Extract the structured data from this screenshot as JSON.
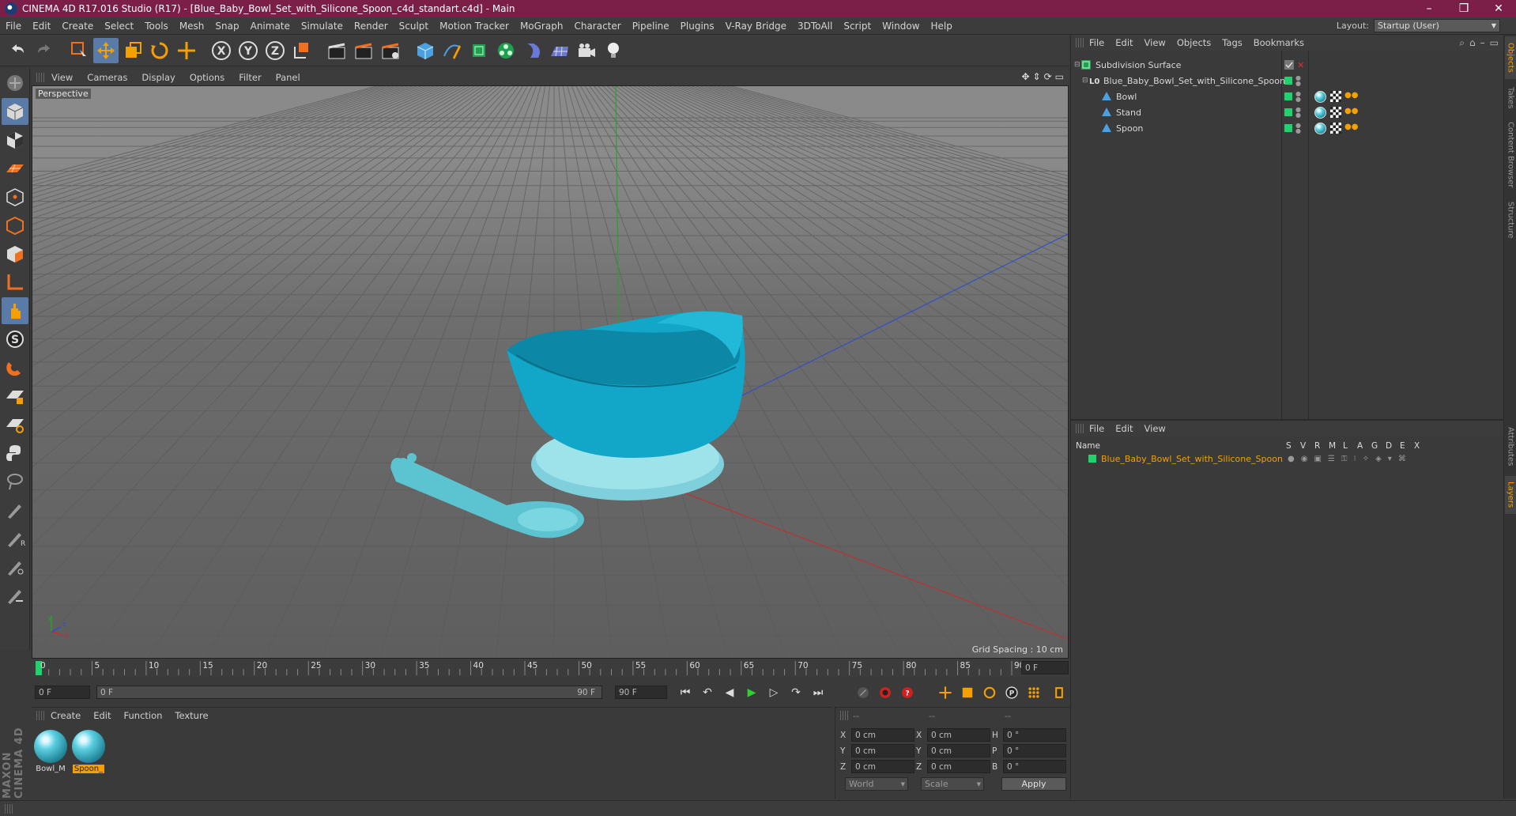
{
  "window": {
    "title": "CINEMA 4D R17.016 Studio (R17) - [Blue_Baby_Bowl_Set_with_Silicone_Spoon_c4d_standart.c4d] - Main",
    "min": "–",
    "max": "❒",
    "close": "✕"
  },
  "menubar": {
    "items": [
      "File",
      "Edit",
      "Create",
      "Select",
      "Tools",
      "Mesh",
      "Snap",
      "Animate",
      "Simulate",
      "Render",
      "Sculpt",
      "Motion Tracker",
      "MoGraph",
      "Character",
      "Pipeline",
      "Plugins",
      "V-Ray Bridge",
      "3DToAll",
      "Script",
      "Window",
      "Help"
    ],
    "layout_label": "Layout:",
    "layout_value": "Startup (User)"
  },
  "viewport": {
    "menu": [
      "View",
      "Cameras",
      "Display",
      "Options",
      "Filter",
      "Panel"
    ],
    "label": "Perspective",
    "grid_spacing": "Grid Spacing : 10 cm",
    "axis_x": "x",
    "axis_y": "y",
    "axis_z": "z"
  },
  "timeline": {
    "ticks": [
      "0",
      "5",
      "10",
      "15",
      "20",
      "25",
      "30",
      "35",
      "40",
      "45",
      "50",
      "55",
      "60",
      "65",
      "70",
      "75",
      "80",
      "85",
      "90"
    ],
    "current_frame": "0 F"
  },
  "transport": {
    "start": "0 F",
    "range_start": "0 F",
    "range_end": "90 F",
    "end": "90 F"
  },
  "materials": {
    "menu": [
      "Create",
      "Edit",
      "Function",
      "Texture"
    ],
    "items": [
      {
        "name": "Bowl_M"
      },
      {
        "name": "Spoon_"
      }
    ]
  },
  "coords": {
    "header": [
      "--",
      "--",
      "--"
    ],
    "rows": [
      {
        "a": "X",
        "av": "0 cm",
        "b": "X",
        "bv": "0 cm",
        "c": "H",
        "cv": "0 °"
      },
      {
        "a": "Y",
        "av": "0 cm",
        "b": "Y",
        "bv": "0 cm",
        "c": "P",
        "cv": "0 °"
      },
      {
        "a": "Z",
        "av": "0 cm",
        "b": "Z",
        "bv": "0 cm",
        "c": "B",
        "cv": "0 °"
      }
    ],
    "mode": "World",
    "type": "Scale",
    "apply": "Apply"
  },
  "object_manager": {
    "menu": [
      "File",
      "Edit",
      "View",
      "Objects",
      "Tags",
      "Bookmarks"
    ],
    "tree": [
      {
        "name": "Subdivision Surface"
      },
      {
        "name": "Blue_Baby_Bowl_Set_with_Silicone_Spoon"
      },
      {
        "name": "Bowl"
      },
      {
        "name": "Stand"
      },
      {
        "name": "Spoon"
      }
    ]
  },
  "layer_manager": {
    "menu": [
      "File",
      "Edit",
      "View"
    ],
    "name_col": "Name",
    "cols": [
      "S",
      "V",
      "R",
      "M",
      "L",
      "A",
      "G",
      "D",
      "E",
      "X"
    ],
    "layer": "Blue_Baby_Bowl_Set_with_Silicone_Spoon"
  },
  "side_tabs": [
    "Objects",
    "Takes",
    "Content Browser",
    "Structure",
    "Attributes",
    "Layers"
  ],
  "brand": "MAXON CINEMA 4D"
}
